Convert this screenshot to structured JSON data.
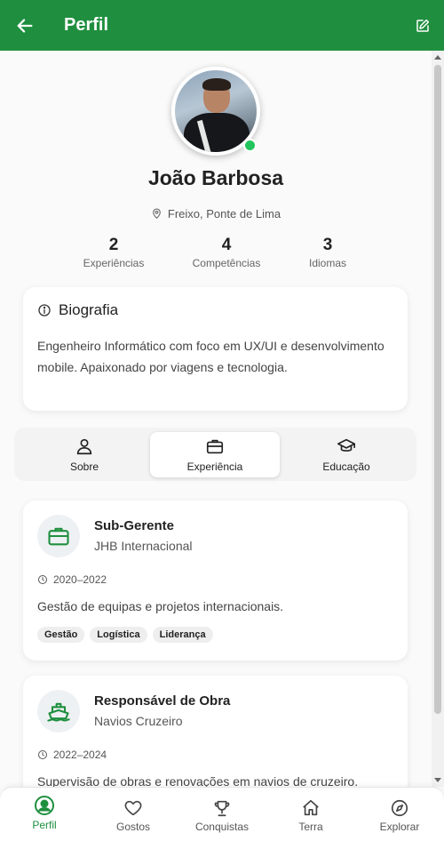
{
  "appbar": {
    "title": "Perfil"
  },
  "profile": {
    "name": "João Barbosa",
    "location": "Freixo, Ponte de Lima",
    "online": true
  },
  "stats": [
    {
      "value": "2",
      "label": "Experiências"
    },
    {
      "value": "4",
      "label": "Competências"
    },
    {
      "value": "3",
      "label": "Idiomas"
    }
  ],
  "bio": {
    "title": "Biografia",
    "text": "Engenheiro Informático com foco em UX/UI e desenvolvimento mobile. Apaixonado por viagens e tecnologia."
  },
  "tabs": [
    {
      "label": "Sobre",
      "icon": "person-icon"
    },
    {
      "label": "Experiência",
      "icon": "briefcase-icon",
      "active": true
    },
    {
      "label": "Educação",
      "icon": "graduation-cap-icon"
    }
  ],
  "experiences": [
    {
      "role": "Sub-Gerente",
      "company": "JHB Internacional",
      "period": "2020–2022",
      "description": "Gestão de equipas e projetos internacionais.",
      "tags": [
        "Gestão",
        "Logística",
        "Liderança"
      ],
      "icon": "briefcase-icon"
    },
    {
      "role": "Responsável de Obra",
      "company": "Navios Cruzeiro",
      "period": "2022–2024",
      "description": "Supervisão de obras e renovações em navios de cruzeiro.",
      "icon": "ship-icon"
    }
  ],
  "bottom_nav": [
    {
      "label": "Perfil",
      "icon": "profile-icon",
      "active": true
    },
    {
      "label": "Gostos",
      "icon": "heart-icon"
    },
    {
      "label": "Conquistas",
      "icon": "trophy-icon"
    },
    {
      "label": "Terra",
      "icon": "home-icon"
    },
    {
      "label": "Explorar",
      "icon": "compass-icon"
    }
  ],
  "colors": {
    "primary": "#1f8f3f",
    "online": "#22c55e"
  }
}
